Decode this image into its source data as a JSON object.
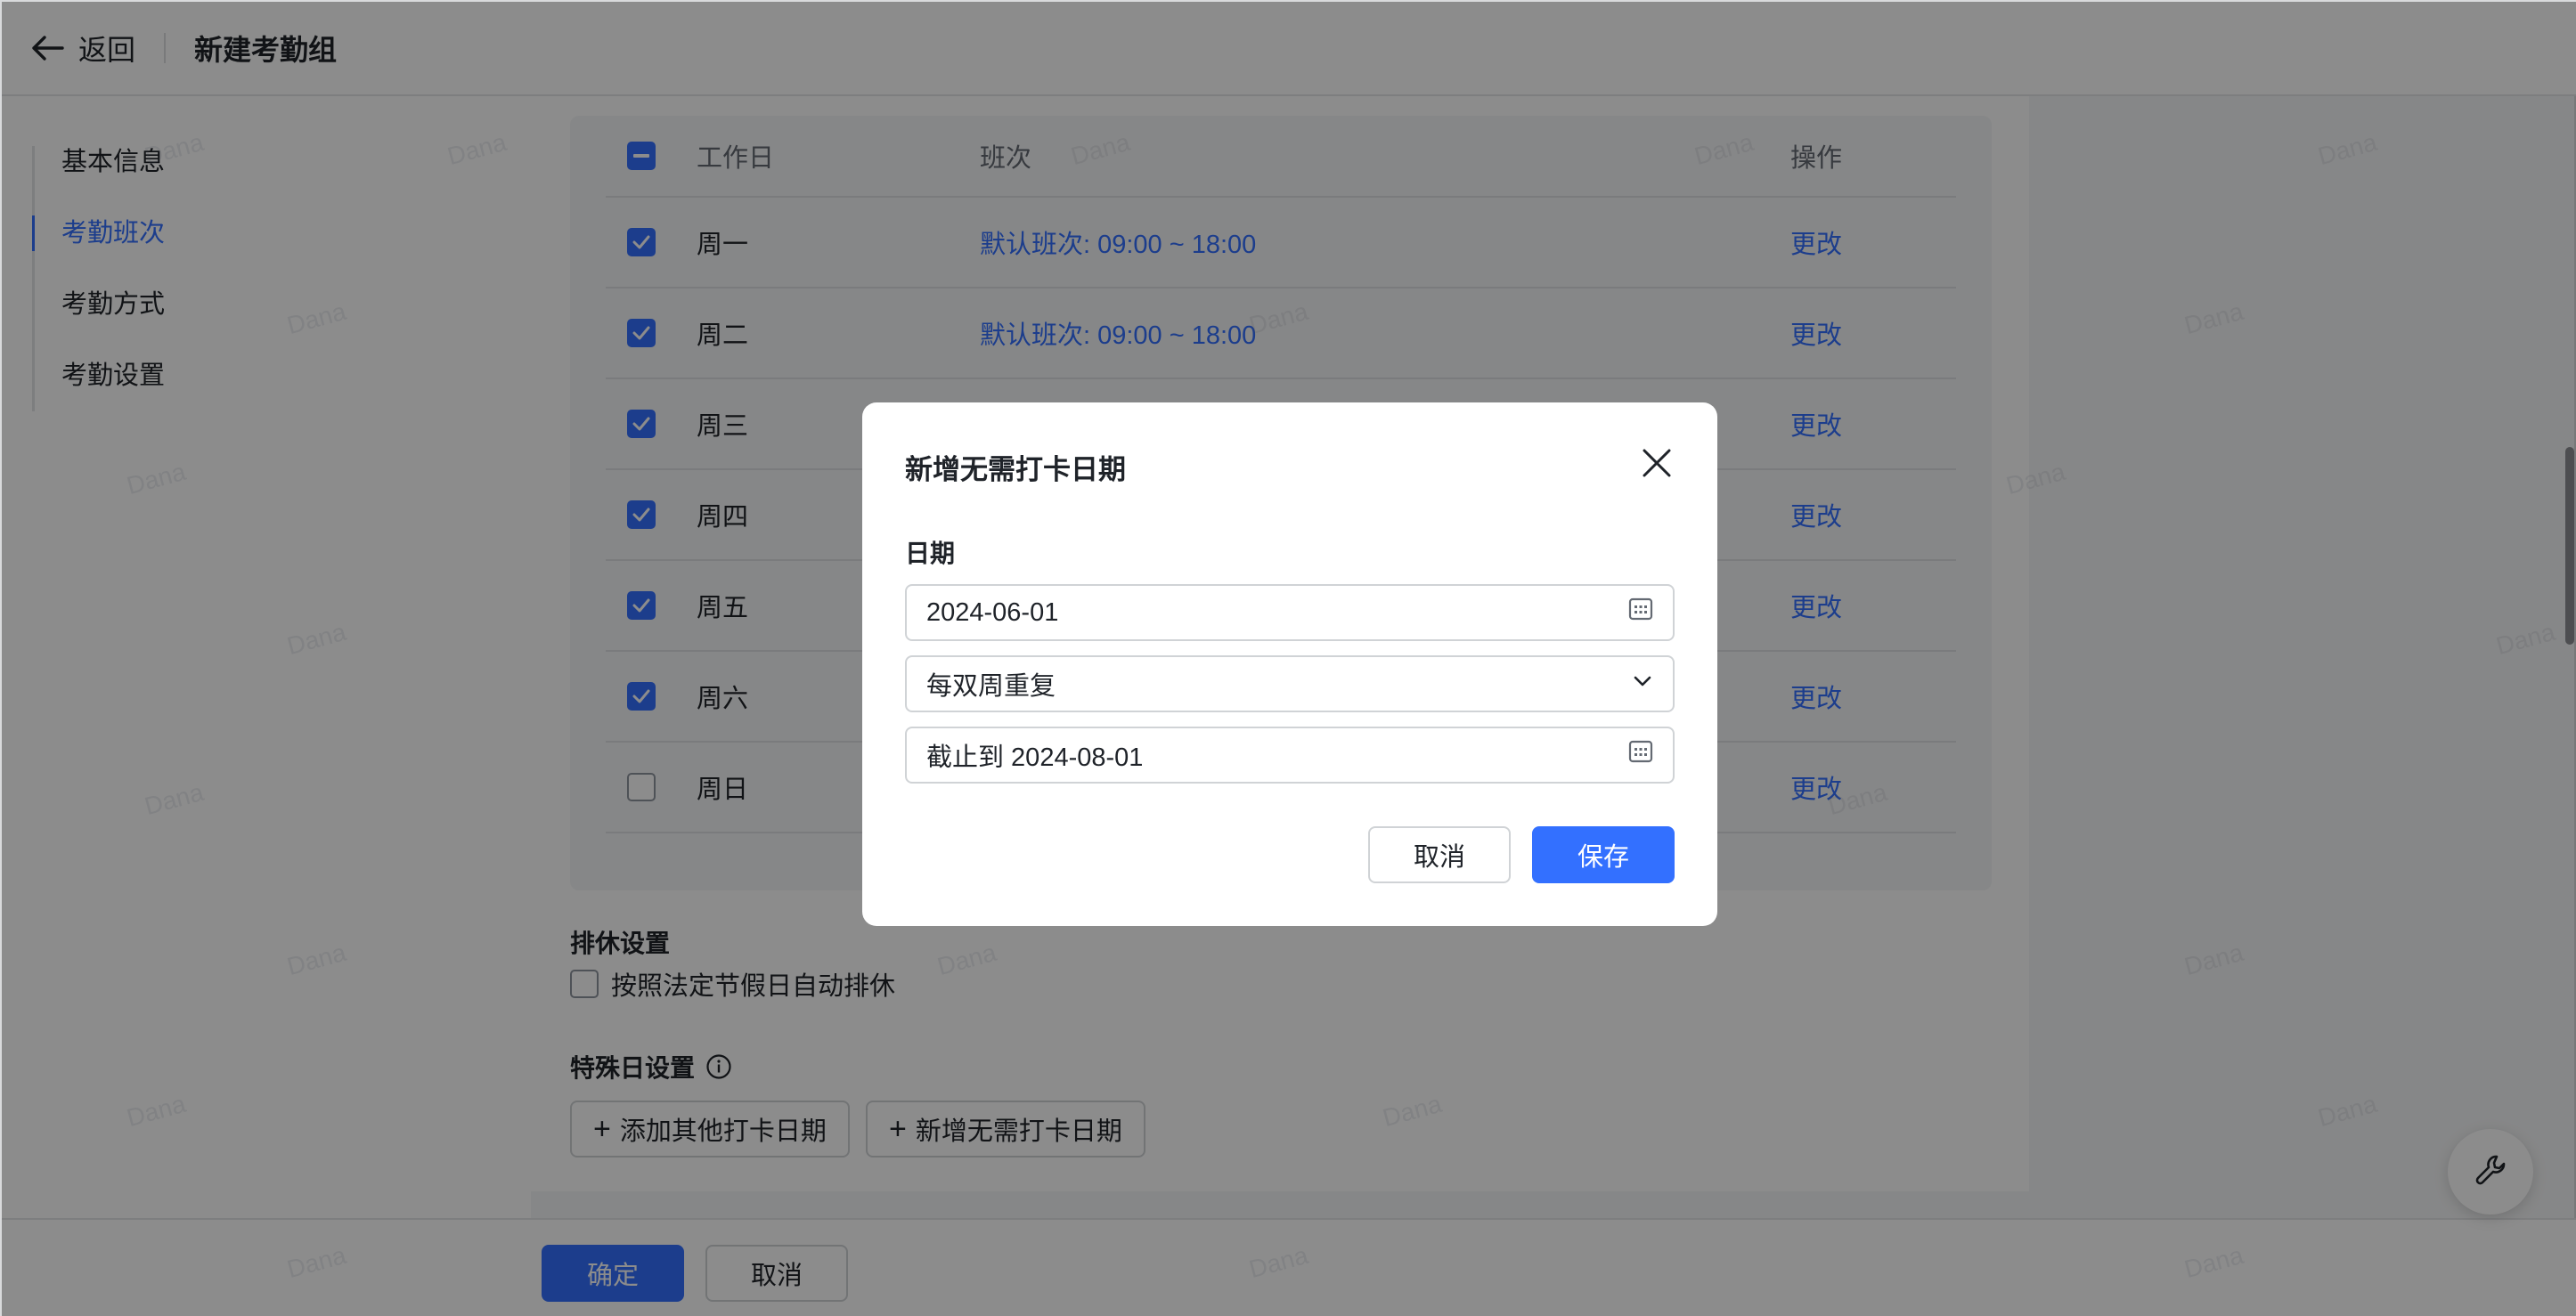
{
  "header": {
    "back_label": "返回",
    "title": "新建考勤组"
  },
  "sidebar": {
    "items": [
      {
        "label": "基本信息"
      },
      {
        "label": "考勤班次"
      },
      {
        "label": "考勤方式"
      },
      {
        "label": "考勤设置"
      }
    ],
    "active_index": 1
  },
  "table": {
    "headers": {
      "workday": "工作日",
      "shift": "班次",
      "action": "操作"
    },
    "rows": [
      {
        "day": "周一",
        "shift": "默认班次: 09:00 ~ 18:00",
        "action": "更改",
        "checked": true
      },
      {
        "day": "周二",
        "shift": "默认班次: 09:00 ~ 18:00",
        "action": "更改",
        "checked": true
      },
      {
        "day": "周三",
        "shift": "",
        "action": "更改",
        "checked": true
      },
      {
        "day": "周四",
        "shift": "",
        "action": "更改",
        "checked": true
      },
      {
        "day": "周五",
        "shift": "",
        "action": "更改",
        "checked": true
      },
      {
        "day": "周六",
        "shift": "",
        "action": "更改",
        "checked": true
      },
      {
        "day": "周日",
        "shift": "",
        "action": "更改",
        "checked": false
      }
    ]
  },
  "rest": {
    "title": "排休设置",
    "option": "按照法定节假日自动排休"
  },
  "special": {
    "title": "特殊日设置",
    "add_other": "添加其他打卡日期",
    "add_none": "新增无需打卡日期"
  },
  "footer": {
    "confirm": "确定",
    "cancel": "取消"
  },
  "watermark": "Dana",
  "modal": {
    "title": "新增无需打卡日期",
    "date_label": "日期",
    "date_value": "2024-06-01",
    "repeat_value": "每双周重复",
    "until_value": "截止到 2024-08-01",
    "cancel": "取消",
    "save": "保存"
  },
  "colors": {
    "accent": "#3370ff",
    "text": "#1f2329",
    "overlay": "rgba(0,0,0,0.45)"
  }
}
